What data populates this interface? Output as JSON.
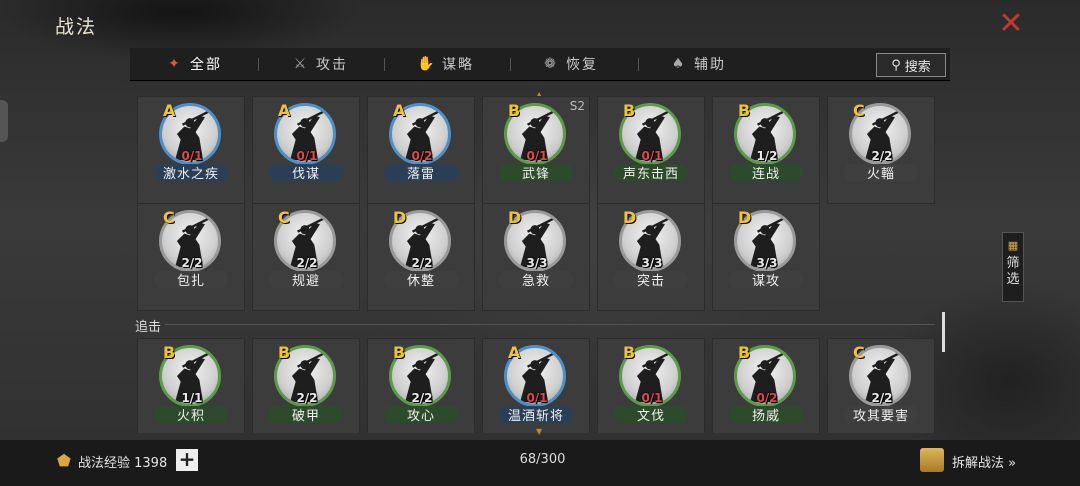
{
  "title": "战法",
  "close_icon": "close-icon",
  "tabs": [
    {
      "label": "全部",
      "icon": "all-icon",
      "active": true
    },
    {
      "label": "攻击",
      "icon": "crossed-swords-icon",
      "active": false
    },
    {
      "label": "谋略",
      "icon": "scroll-icon",
      "active": false
    },
    {
      "label": "恢复",
      "icon": "recover-icon",
      "active": false
    },
    {
      "label": "辅助",
      "icon": "support-icon",
      "active": false
    }
  ],
  "search": {
    "label": "搜索",
    "icon": "search-icon"
  },
  "filter": {
    "label1": "筛",
    "label2": "选",
    "icon": "filter-icon"
  },
  "colors": {
    "accent_red": "#c0392b",
    "grade_gold": "#f2c233",
    "rank_A": "#4d8fc7",
    "rank_B": "#5b9c4b",
    "rank_C": "#9a9a9a"
  },
  "rows": [
    [
      {
        "grade": "A",
        "count": "0/1",
        "count_color": "red",
        "name": "激水之疾",
        "rank": "A"
      },
      {
        "grade": "A",
        "count": "0/1",
        "count_color": "red",
        "name": "伐谋",
        "rank": "A"
      },
      {
        "grade": "A",
        "count": "0/2",
        "count_color": "red",
        "name": "落雷",
        "rank": "A"
      },
      {
        "grade": "B",
        "count": "0/1",
        "count_color": "red",
        "name": "武锋",
        "rank": "B",
        "tag": "S2"
      },
      {
        "grade": "B",
        "count": "0/1",
        "count_color": "red",
        "name": "声东击西",
        "rank": "B"
      },
      {
        "grade": "B",
        "count": "1/2",
        "count_color": "white",
        "name": "连战",
        "rank": "B"
      },
      {
        "grade": "C",
        "count": "2/2",
        "count_color": "white",
        "name": "火輜",
        "rank": "C"
      }
    ],
    [
      {
        "grade": "C",
        "count": "2/2",
        "count_color": "white",
        "name": "包扎",
        "rank": "C"
      },
      {
        "grade": "C",
        "count": "2/2",
        "count_color": "white",
        "name": "规避",
        "rank": "C"
      },
      {
        "grade": "D",
        "count": "2/2",
        "count_color": "white",
        "name": "休整",
        "rank": "D"
      },
      {
        "grade": "D",
        "count": "3/3",
        "count_color": "white",
        "name": "急救",
        "rank": "D"
      },
      {
        "grade": "D",
        "count": "3/3",
        "count_color": "white",
        "name": "突击",
        "rank": "D"
      },
      {
        "grade": "D",
        "count": "3/3",
        "count_color": "white",
        "name": "谋攻",
        "rank": "D"
      }
    ],
    [
      {
        "grade": "B",
        "count": "1/1",
        "count_color": "white",
        "name": "火积",
        "rank": "B"
      },
      {
        "grade": "B",
        "count": "2/2",
        "count_color": "white",
        "name": "破甲",
        "rank": "B"
      },
      {
        "grade": "B",
        "count": "2/2",
        "count_color": "white",
        "name": "攻心",
        "rank": "B"
      },
      {
        "grade": "A",
        "count": "0/1",
        "count_color": "red",
        "name": "温酒斩将",
        "rank": "A"
      },
      {
        "grade": "B",
        "count": "0/1",
        "count_color": "red",
        "name": "文伐",
        "rank": "B"
      },
      {
        "grade": "B",
        "count": "0/2",
        "count_color": "red",
        "name": "扬威",
        "rank": "B"
      },
      {
        "grade": "C",
        "count": "2/2",
        "count_color": "white",
        "name": "攻其要害",
        "rank": "C"
      }
    ]
  ],
  "section_label": "追击",
  "bottom": {
    "exp_label": "战法经验 1398",
    "exp_icon": "exp-icon",
    "plus_label": "+",
    "page": "68/300",
    "disassemble_label": "拆解战法 »",
    "disassemble_icon": "disassemble-icon"
  }
}
